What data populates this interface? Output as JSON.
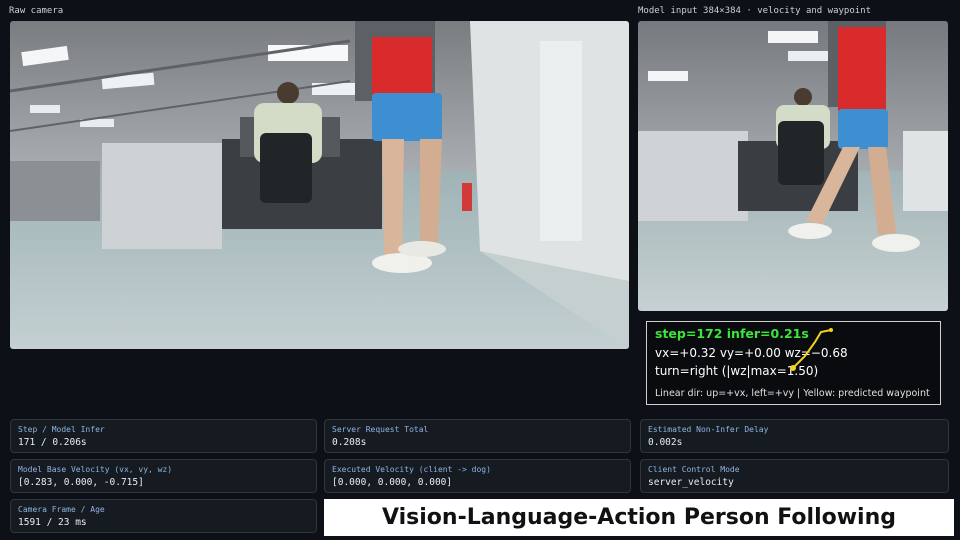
{
  "raw_camera": {
    "label": "Raw camera"
  },
  "model_input": {
    "label": "Model input 384×384 · velocity and waypoint"
  },
  "overlay": {
    "step_line": "step=172  infer=0.21s",
    "velocity_line": "vx=+0.32   vy=+0.00   wz=−0.68",
    "turn_line": "turn=right  (|wz|max=1.50)",
    "legend_line": "Linear dir: up=+vx, left=+vy  |  Yellow: predicted waypoint",
    "colors": {
      "step": "#39e639",
      "waypoint": "#f2d21b",
      "text": "#ffffff"
    }
  },
  "cards": [
    {
      "title": "Step / Model Infer",
      "value": "171 / 0.206s"
    },
    {
      "title": "Server Request Total",
      "value": "0.208s"
    },
    {
      "title": "Estimated Non-Infer Delay",
      "value": "0.002s"
    },
    {
      "title": "Model Base Velocity (vx, vy, wz)",
      "value": "[0.283, 0.000, -0.715]"
    },
    {
      "title": "Executed Velocity (client -> dog)",
      "value": "[0.000, 0.000, 0.000]"
    },
    {
      "title": "Client Control Mode",
      "value": "server_velocity"
    },
    {
      "title": "Camera Frame / Age",
      "value": "1591 / 23 ms"
    }
  ],
  "banner": {
    "title": "Vision-Language-Action Person Following"
  }
}
